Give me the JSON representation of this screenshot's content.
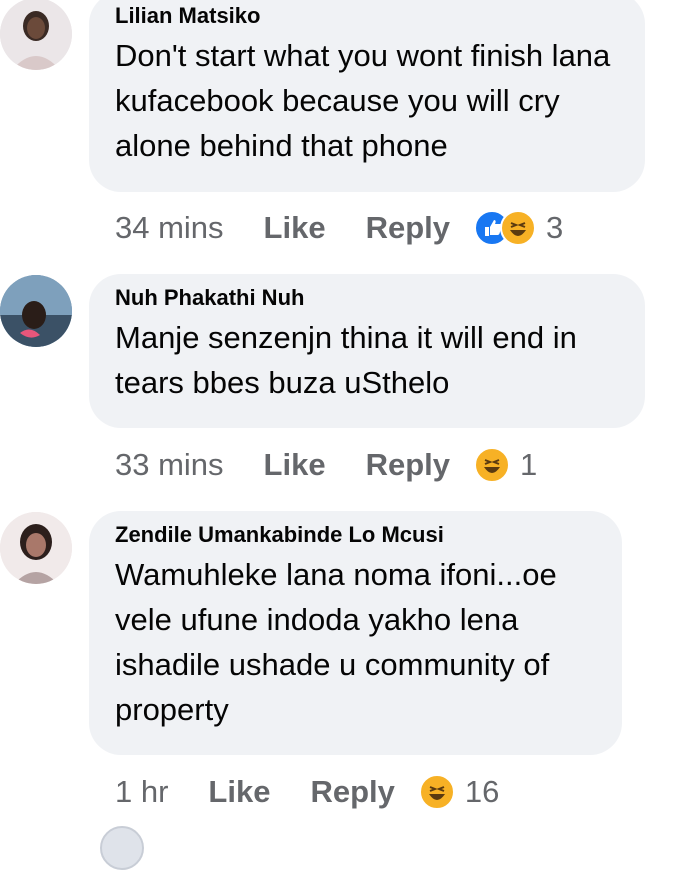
{
  "comments": [
    {
      "author": "Lilian Matsiko",
      "text": "Don't start what you wont finish lana kufacebook because you will cry alone behind that phone",
      "time": "34 mins",
      "like": "Like",
      "reply": "Reply",
      "reactions": [
        "like-icon",
        "haha-icon"
      ],
      "reaction_count": "3",
      "avatar_icon": "user-avatar"
    },
    {
      "author": "Nuh Phakathi Nuh",
      "text": "Manje senzenjn thina it will end in tears bbes buza uSthelo",
      "time": "33 mins",
      "like": "Like",
      "reply": "Reply",
      "reactions": [
        "haha-icon"
      ],
      "reaction_count": "1",
      "avatar_icon": "user-avatar"
    },
    {
      "author": "Zendile Umankabinde Lo Mcusi",
      "text": "Wamuhleke lana noma ifoni...oe vele ufune indoda yakho lena ishadile ushade u community of property",
      "time": "1 hr",
      "like": "Like",
      "reply": "Reply",
      "reactions": [
        "haha-icon"
      ],
      "reaction_count": "16",
      "avatar_icon": "user-avatar"
    }
  ],
  "colors": {
    "bubble": "#f0f2f5",
    "meta": "#65676b",
    "text": "#050505",
    "like_blue": "#1877f2",
    "haha_yellow": "#f7b125"
  }
}
